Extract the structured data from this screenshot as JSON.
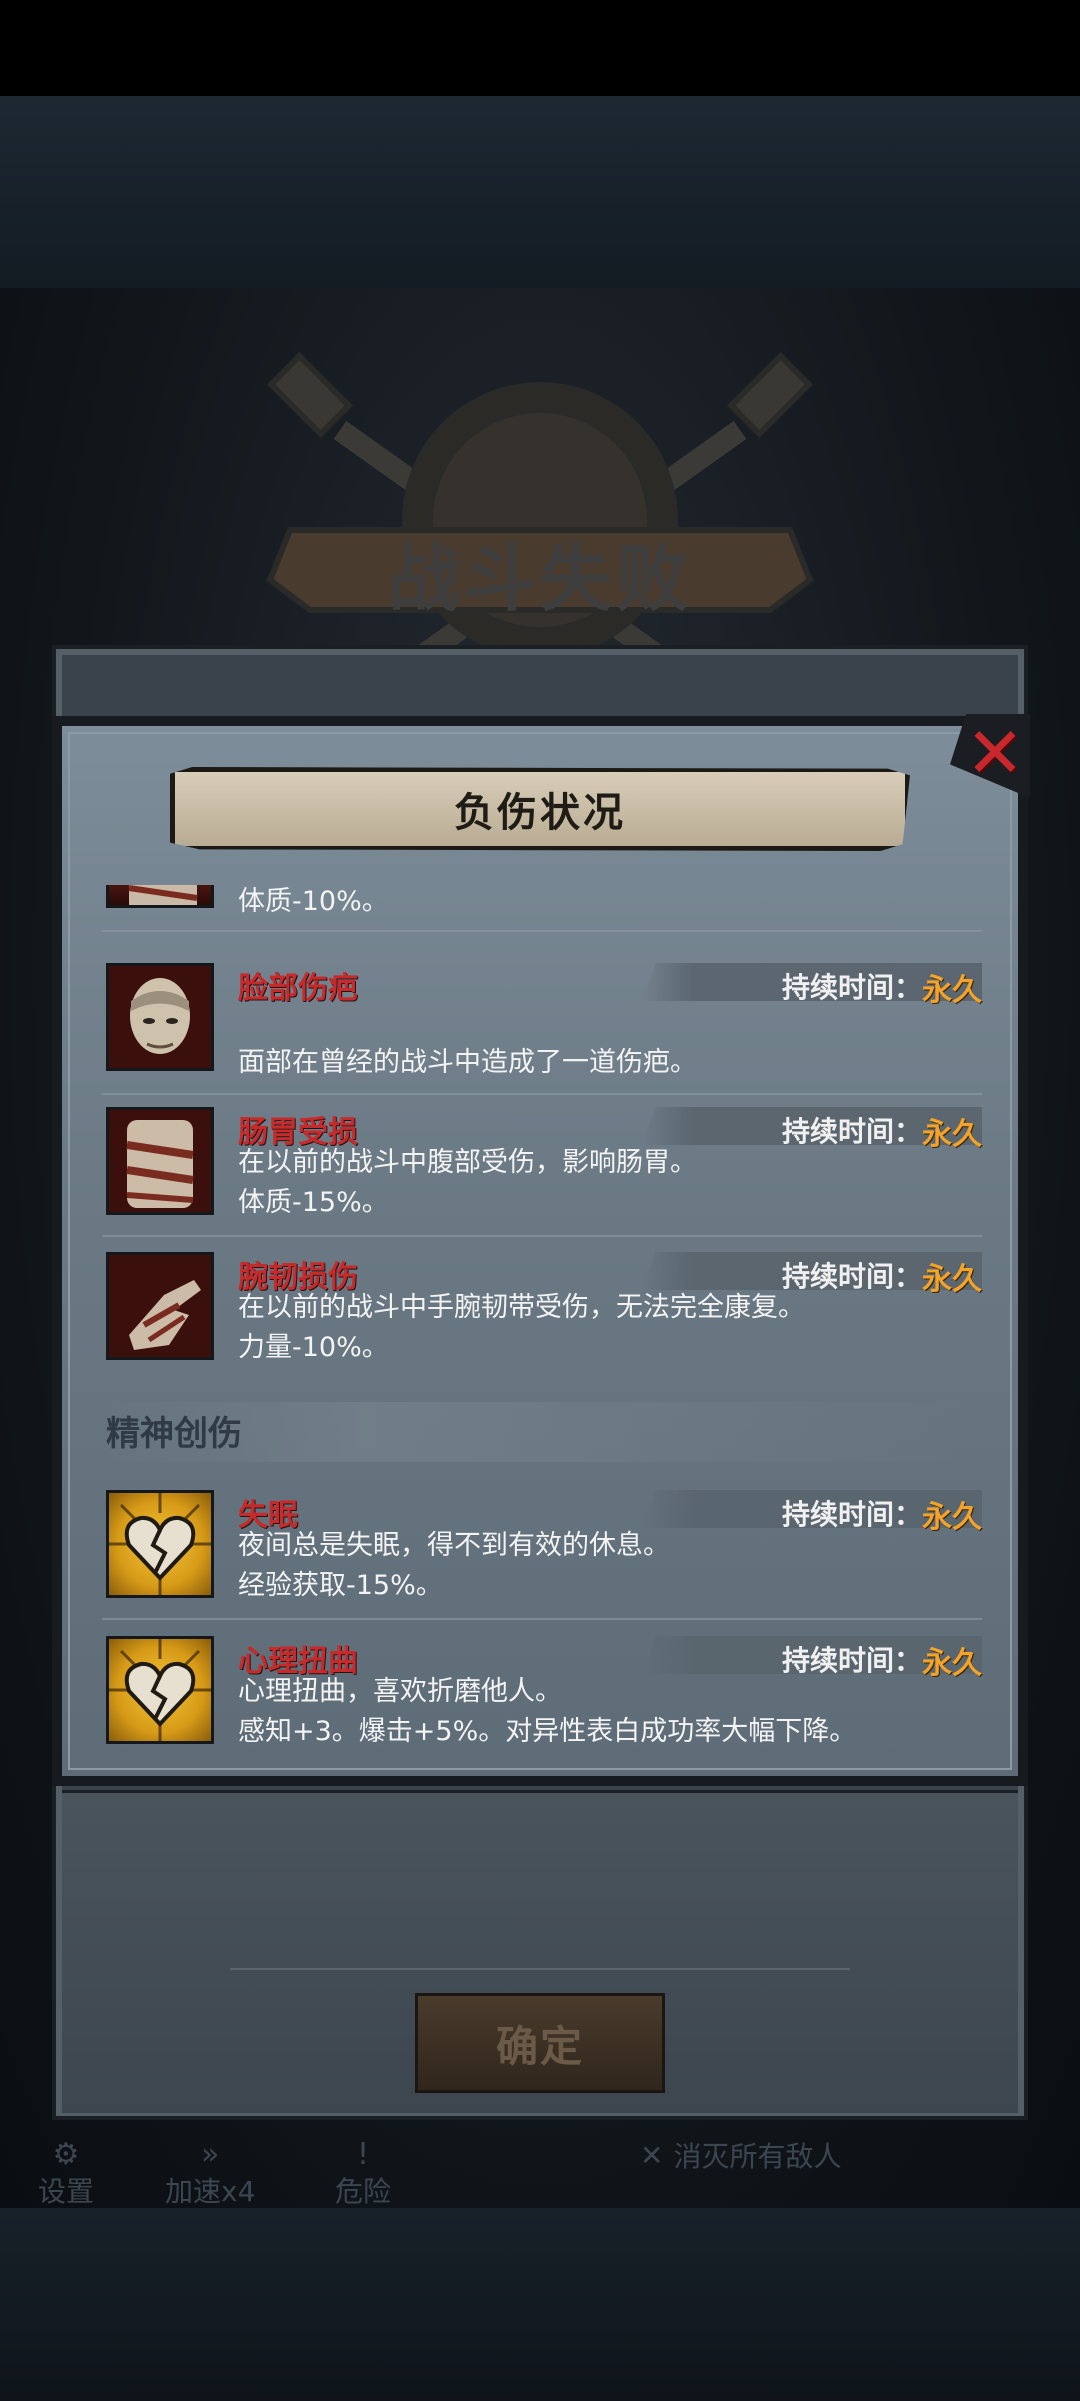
{
  "background": {
    "crest_title": "战斗失败"
  },
  "dialog": {
    "title": "负伤状况",
    "close_icon": "close-x-icon",
    "duration_label": "持续时间：",
    "physical_entries": [
      {
        "name": "",
        "duration": "",
        "desc": [
          "体质-10%。"
        ],
        "icon": "bandaged-torso-icon"
      },
      {
        "name": "脸部伤疤",
        "duration": "永久",
        "desc": [
          "面部在曾经的战斗中造成了一道伤疤。"
        ],
        "icon": "scarred-face-icon"
      },
      {
        "name": "肠胃受损",
        "duration": "永久",
        "desc": [
          "在以前的战斗中腹部受伤，影响肠胃。",
          "体质-15%。"
        ],
        "icon": "bandaged-torso-icon"
      },
      {
        "name": "腕韧损伤",
        "duration": "永久",
        "desc": [
          "在以前的战斗中手腕韧带受伤，无法完全康复。",
          "力量-10%。"
        ],
        "icon": "bandaged-hand-icon"
      }
    ],
    "mental_section_title": "精神创伤",
    "mental_entries": [
      {
        "name": "失眠",
        "duration": "永久",
        "desc": [
          "夜间总是失眠，得不到有效的休息。",
          "经验获取-15%。"
        ],
        "icon": "broken-heart-icon"
      },
      {
        "name": "心理扭曲",
        "duration": "永久",
        "desc": [
          "心理扭曲，喜欢折磨他人。",
          "感知+3。爆击+5%。对异性表白成功率大幅下降。"
        ],
        "icon": "broken-heart-icon"
      }
    ]
  },
  "confirm_label": "确定",
  "hud": {
    "settings": "设置",
    "speed": "加速x4",
    "danger": "危险",
    "kill_all": "消灭所有敌人"
  },
  "colors": {
    "injury_name": "#c62a2a",
    "duration_value": "#f1a32b",
    "panel": "#6a7984"
  }
}
